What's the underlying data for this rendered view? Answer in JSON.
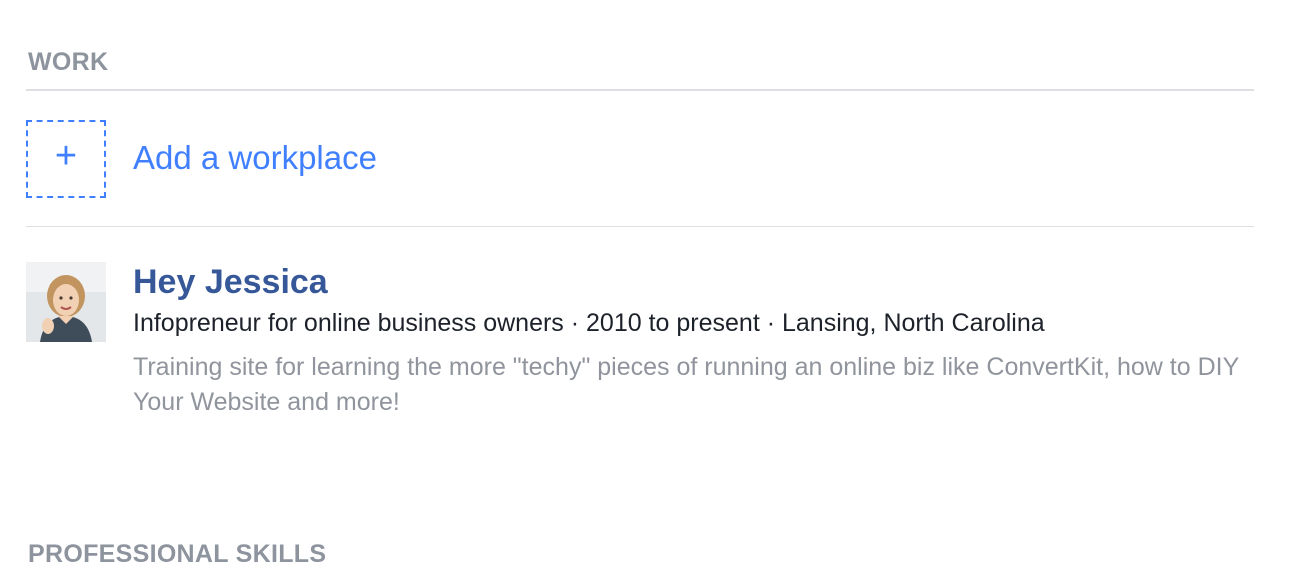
{
  "work_section": {
    "title": "WORK",
    "add_icon": "plus-icon",
    "add_label": "Add a workplace",
    "entries": [
      {
        "name": "Hey Jessica",
        "meta": "Infopreneur for online business owners · 2010 to present · Lansing, North Carolina",
        "description": "Training site for learning the more \"techy\" pieces of running an online biz like ConvertKit, how to DIY Your Website and more!"
      }
    ]
  },
  "skills_section": {
    "title": "PROFESSIONAL SKILLS"
  },
  "colors": {
    "link": "#4080ff",
    "name": "#365899",
    "heading": "#8d949e",
    "muted": "#90949c",
    "divider": "#dddfe2"
  }
}
